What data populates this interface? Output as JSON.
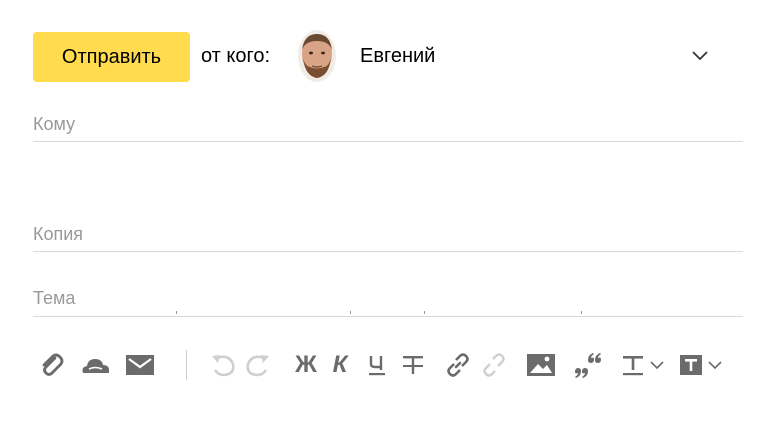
{
  "compose": {
    "send_label": "Отправить",
    "from_label": "от кого:",
    "sender_name": "Евгений"
  },
  "fields": {
    "to_label": "Кому",
    "cc_label": "Копия",
    "subject_label": "Тема"
  },
  "toolbar": {
    "icons": [
      "paperclip-icon",
      "cloud-icon",
      "envelope-icon",
      "undo-icon",
      "redo-icon",
      "bold-icon",
      "italic-icon",
      "underline-icon",
      "strikethrough-icon",
      "link-icon",
      "unlink-icon",
      "image-icon",
      "quote-icon",
      "text-color-icon",
      "background-color-icon"
    ],
    "bold_glyph": "Ж",
    "italic_glyph": "К",
    "underline_glyph": "Ч"
  },
  "colors": {
    "send_button": "#ffdb4d",
    "icon_active": "#6b6b6b",
    "icon_disabled": "#cfcfcf",
    "label": "#999999"
  }
}
